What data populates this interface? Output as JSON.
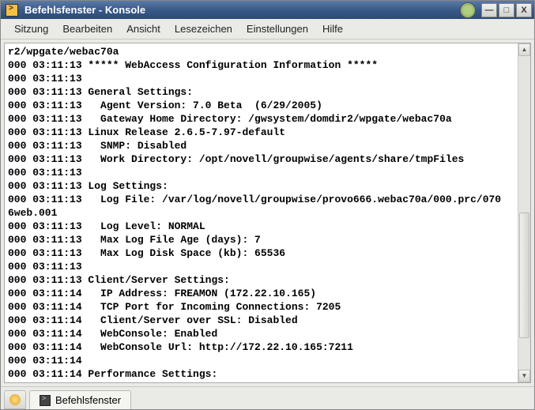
{
  "window": {
    "title": "Befehlsfenster - Konsole"
  },
  "menubar": {
    "items": [
      {
        "label": "Sitzung"
      },
      {
        "label": "Bearbeiten"
      },
      {
        "label": "Ansicht"
      },
      {
        "label": "Lesezeichen"
      },
      {
        "label": "Einstellungen"
      },
      {
        "label": "Hilfe"
      }
    ]
  },
  "terminal": {
    "lines": [
      "r2/wpgate/webac70a",
      "000 03:11:13 ***** WebAccess Configuration Information *****",
      "000 03:11:13",
      "000 03:11:13 General Settings:",
      "000 03:11:13   Agent Version: 7.0 Beta  (6/29/2005)",
      "000 03:11:13   Gateway Home Directory: /gwsystem/domdir2/wpgate/webac70a",
      "000 03:11:13 Linux Release 2.6.5-7.97-default",
      "000 03:11:13   SNMP: Disabled",
      "000 03:11:13   Work Directory: /opt/novell/groupwise/agents/share/tmpFiles",
      "000 03:11:13",
      "000 03:11:13 Log Settings:",
      "000 03:11:13   Log File: /var/log/novell/groupwise/provo666.webac70a/000.prc/070",
      "6web.001",
      "000 03:11:13   Log Level: NORMAL",
      "000 03:11:13   Max Log File Age (days): 7",
      "000 03:11:13   Max Log Disk Space (kb): 65536",
      "000 03:11:13",
      "000 03:11:13 Client/Server Settings:",
      "000 03:11:14   IP Address: FREAMON (172.22.10.165)",
      "000 03:11:14   TCP Port for Incoming Connections: 7205",
      "000 03:11:14   Client/Server over SSL: Disabled",
      "000 03:11:14   WebConsole: Enabled",
      "000 03:11:14   WebConsole Url: http://172.22.10.165:7211",
      "000 03:11:14",
      "000 03:11:14 Performance Settings:"
    ]
  },
  "tabbar": {
    "tab_label": "Befehlsfenster"
  },
  "win_controls": {
    "minimize": "—",
    "maximize": "□",
    "close": "X"
  },
  "scroll": {
    "up": "▲",
    "down": "▼"
  }
}
